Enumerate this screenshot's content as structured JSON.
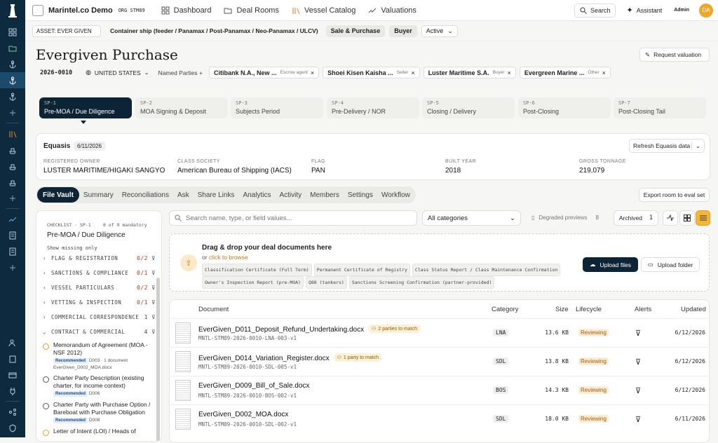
{
  "app": {
    "name": "Marintel.co Demo",
    "org": "ORG STM89",
    "admin": "Admin",
    "avatar": "DA"
  },
  "nav": [
    {
      "label": "Dashboard",
      "icon": "dashboard-icon"
    },
    {
      "label": "Deal Rooms",
      "icon": "folder-icon"
    },
    {
      "label": "Vessel Catalog",
      "icon": "catalog-icon"
    },
    {
      "label": "Valuations",
      "icon": "trend-icon"
    }
  ],
  "header_actions": {
    "search": "Search",
    "assistant": "Assistant"
  },
  "asset": {
    "label": "ASSET: EVER GIVEN",
    "type": "Container ship (feeder / Panamax / Post-Panamax / Neo-Panamax / ULCV)",
    "deal_type": "Sale & Purchase",
    "role": "Buyer",
    "status": "Active"
  },
  "deal": {
    "title": "Evergiven Purchase",
    "id": "2026-0010",
    "country": "UNITED STATES",
    "named_parties": "Named Parties +",
    "request_valuation": "Request valuation"
  },
  "parties": [
    {
      "name": "Citibank N.A., New ...",
      "role": "Escrow agent"
    },
    {
      "name": "Shoei Kisen Kaisha ...",
      "role": "Seller"
    },
    {
      "name": "Luster Maritime S.A.",
      "role": "Buyer"
    },
    {
      "name": "Evergreen Marine ...",
      "role": "Other"
    }
  ],
  "stages": [
    {
      "code": "SP-1",
      "name": "Pre-MOA / Due Diligence"
    },
    {
      "code": "SP-2",
      "name": "MOA Signing & Deposit"
    },
    {
      "code": "SP-3",
      "name": "Subjects Period"
    },
    {
      "code": "SP-4",
      "name": "Pre-Delivery / NOR"
    },
    {
      "code": "SP-5",
      "name": "Closing / Delivery"
    },
    {
      "code": "SP-6",
      "name": "Post-Closing"
    },
    {
      "code": "SP-7",
      "name": "Post-Closing Tail"
    }
  ],
  "equasis": {
    "title": "Equasis",
    "date": "6/11/2026",
    "refresh": "Refresh Equasis data",
    "fields": [
      {
        "label": "REGISTERED OWNER",
        "value": "LUSTER MARITIME/HIGAKI SANGYO"
      },
      {
        "label": "CLASS SOCIETY",
        "value": "American Bureau of Shipping (IACS)"
      },
      {
        "label": "FLAG",
        "value": "PAN"
      },
      {
        "label": "BUILT YEAR",
        "value": "2018"
      },
      {
        "label": "GROSS TONNAGE",
        "value": "219,079"
      }
    ]
  },
  "tabs": [
    "File Vault",
    "Summary",
    "Reconciliations",
    "Ask",
    "Share Links",
    "Analytics",
    "Activity",
    "Members",
    "Settings",
    "Workflow"
  ],
  "export": "Export room to eval set",
  "checklist": {
    "header": "CHECKLIST · SP-1",
    "mandatory": "0 of 9 mandatory",
    "stage": "Pre-MOA / Due Diligence",
    "show_missing": "Show missing only",
    "groups": [
      {
        "name": "FLAG & REGISTRATION",
        "count": "0/2"
      },
      {
        "name": "SANCTIONS & COMPLIANCE",
        "count": "0/1"
      },
      {
        "name": "VESSEL PARTICULARS",
        "count": "0/2"
      },
      {
        "name": "VETTING & INSPECTION",
        "count": "0/1"
      },
      {
        "name": "COMMERCIAL CORRESPONDENCE",
        "count": "1"
      },
      {
        "name": "CONTRACT & COMMERCIAL",
        "count": "4"
      }
    ],
    "items": [
      {
        "title": "Memorandum of Agreement (MOA - NSF 2012)",
        "badge": "Recommended",
        "meta": "D003 · 1 document",
        "file": "EverGiven_D002_MOA.docx"
      },
      {
        "title": "Charter Party Description (existing charter, for income context)",
        "badge": "Recommended",
        "meta": "D006"
      },
      {
        "title": "Charter Party with Purchase Option / Bareboat with Purchase Obligation",
        "badge": "Recommended",
        "meta": "D008"
      },
      {
        "title": "Letter of Intent (LOI) / Heads of",
        "badge": "",
        "meta": ""
      }
    ]
  },
  "toolbar": {
    "search_placeholder": "Search name, type, or field values...",
    "category": "All categories",
    "degraded": "Degraded previews",
    "degraded_count": "8",
    "archived": "Archived",
    "archived_count": "1"
  },
  "upload": {
    "title": "Drag & drop your deal documents here",
    "or": "or",
    "browse": "click to browse",
    "upload_files": "Upload files",
    "upload_folder": "Upload folder",
    "types": [
      "Classification Certificate (Full Term)",
      "Permanent Certificate of Registry",
      "Class Status Report / Class Maintenance Confirmation",
      "Owner's Inspection Report (pre-MOA)",
      "Q88 (tankers)",
      "Sanctions Screening Confirmation (partner-provided)"
    ]
  },
  "table": {
    "columns": [
      "Document",
      "Category",
      "Size",
      "Lifecycle",
      "Alerts",
      "Updated"
    ],
    "rows": [
      {
        "name": "EverGiven_D011_Deposit_Refund_Undertaking.docx",
        "match": "2 parties to match",
        "ref": "MNTL-STM89-2026-0010-LNA-003-v1",
        "category": "LNA",
        "size": "13.6 KB",
        "lifecycle": "Reviewing",
        "updated": "6/12/2026"
      },
      {
        "name": "EverGiven_D014_Variation_Register.docx",
        "match": "1 party to match",
        "ref": "MNTL-STM89-2026-0010-SDL-005-v1",
        "category": "SDL",
        "size": "13.8 KB",
        "lifecycle": "Reviewing",
        "updated": "6/12/2026"
      },
      {
        "name": "EverGiven_D009_Bill_of_Sale.docx",
        "match": "",
        "ref": "MNTL-STM89-2026-0010-BOS-002-v1",
        "category": "BOS",
        "size": "14.3 KB",
        "lifecycle": "Reviewing",
        "updated": "6/12/2026"
      },
      {
        "name": "EverGiven_D002_MOA.docx",
        "match": "",
        "ref": "MNTL-STM89-2026-0010-SDL-002-v1",
        "category": "SDL",
        "size": "18.0 KB",
        "lifecycle": "Reviewing",
        "updated": "6/11/2026"
      }
    ]
  }
}
